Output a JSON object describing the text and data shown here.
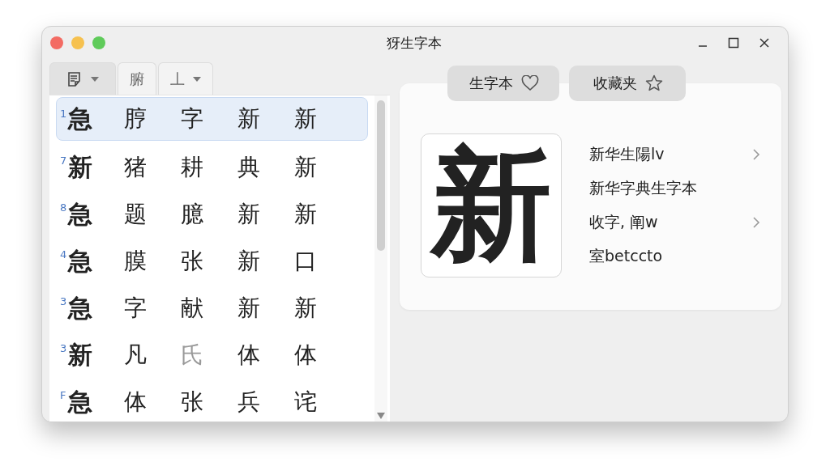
{
  "window": {
    "title": "犽生字本"
  },
  "tabs": [
    {
      "kind": "icon",
      "selected": true
    },
    {
      "kind": "text",
      "label": "腑",
      "selected": false
    },
    {
      "kind": "text",
      "label": "丄",
      "selected": false
    }
  ],
  "char_list": [
    {
      "index": "1",
      "selected": true,
      "cells": [
        {
          "text": "急",
          "dimmed": false
        },
        {
          "text": "脝",
          "dimmed": false
        },
        {
          "text": "字",
          "dimmed": false
        },
        {
          "text": "新",
          "dimmed": false
        },
        {
          "text": "新",
          "dimmed": false
        }
      ]
    },
    {
      "index": "7",
      "selected": false,
      "cells": [
        {
          "text": "新",
          "dimmed": false
        },
        {
          "text": "猪",
          "dimmed": false
        },
        {
          "text": "耕",
          "dimmed": false
        },
        {
          "text": "典",
          "dimmed": false
        },
        {
          "text": "新",
          "dimmed": false
        }
      ]
    },
    {
      "index": "8",
      "selected": false,
      "cells": [
        {
          "text": "急",
          "dimmed": false
        },
        {
          "text": "题",
          "dimmed": false
        },
        {
          "text": "臆",
          "dimmed": false
        },
        {
          "text": "新",
          "dimmed": false
        },
        {
          "text": "新",
          "dimmed": false
        }
      ]
    },
    {
      "index": "4",
      "selected": false,
      "cells": [
        {
          "text": "急",
          "dimmed": false
        },
        {
          "text": "膜",
          "dimmed": false
        },
        {
          "text": "张",
          "dimmed": false
        },
        {
          "text": "新",
          "dimmed": false
        },
        {
          "text": "口",
          "dimmed": false
        }
      ]
    },
    {
      "index": "3",
      "selected": false,
      "cells": [
        {
          "text": "急",
          "dimmed": false
        },
        {
          "text": "字",
          "dimmed": false
        },
        {
          "text": "献",
          "dimmed": false
        },
        {
          "text": "新",
          "dimmed": false
        },
        {
          "text": "新",
          "dimmed": false
        }
      ]
    },
    {
      "index": "3",
      "selected": false,
      "cells": [
        {
          "text": "新",
          "dimmed": false
        },
        {
          "text": "凡",
          "dimmed": false
        },
        {
          "text": "氏",
          "dimmed": true
        },
        {
          "text": "体",
          "dimmed": false
        },
        {
          "text": "体",
          "dimmed": false
        }
      ]
    },
    {
      "index": "F",
      "selected": false,
      "cells": [
        {
          "text": "急",
          "dimmed": false
        },
        {
          "text": "体",
          "dimmed": false
        },
        {
          "text": "张",
          "dimmed": false
        },
        {
          "text": "兵",
          "dimmed": false
        },
        {
          "text": "诧",
          "dimmed": false
        }
      ]
    }
  ],
  "action_buttons": [
    {
      "label": "生字本"
    },
    {
      "label": "收藏夹"
    }
  ],
  "detail": {
    "character": "新",
    "entries": [
      {
        "text": "新华生陽lv",
        "has_arrow": true
      },
      {
        "text": "新华字典生字本",
        "has_arrow": false
      },
      {
        "text": "收字, 阐w",
        "has_arrow": true
      },
      {
        "text": "室betccto",
        "has_arrow": false
      }
    ]
  }
}
